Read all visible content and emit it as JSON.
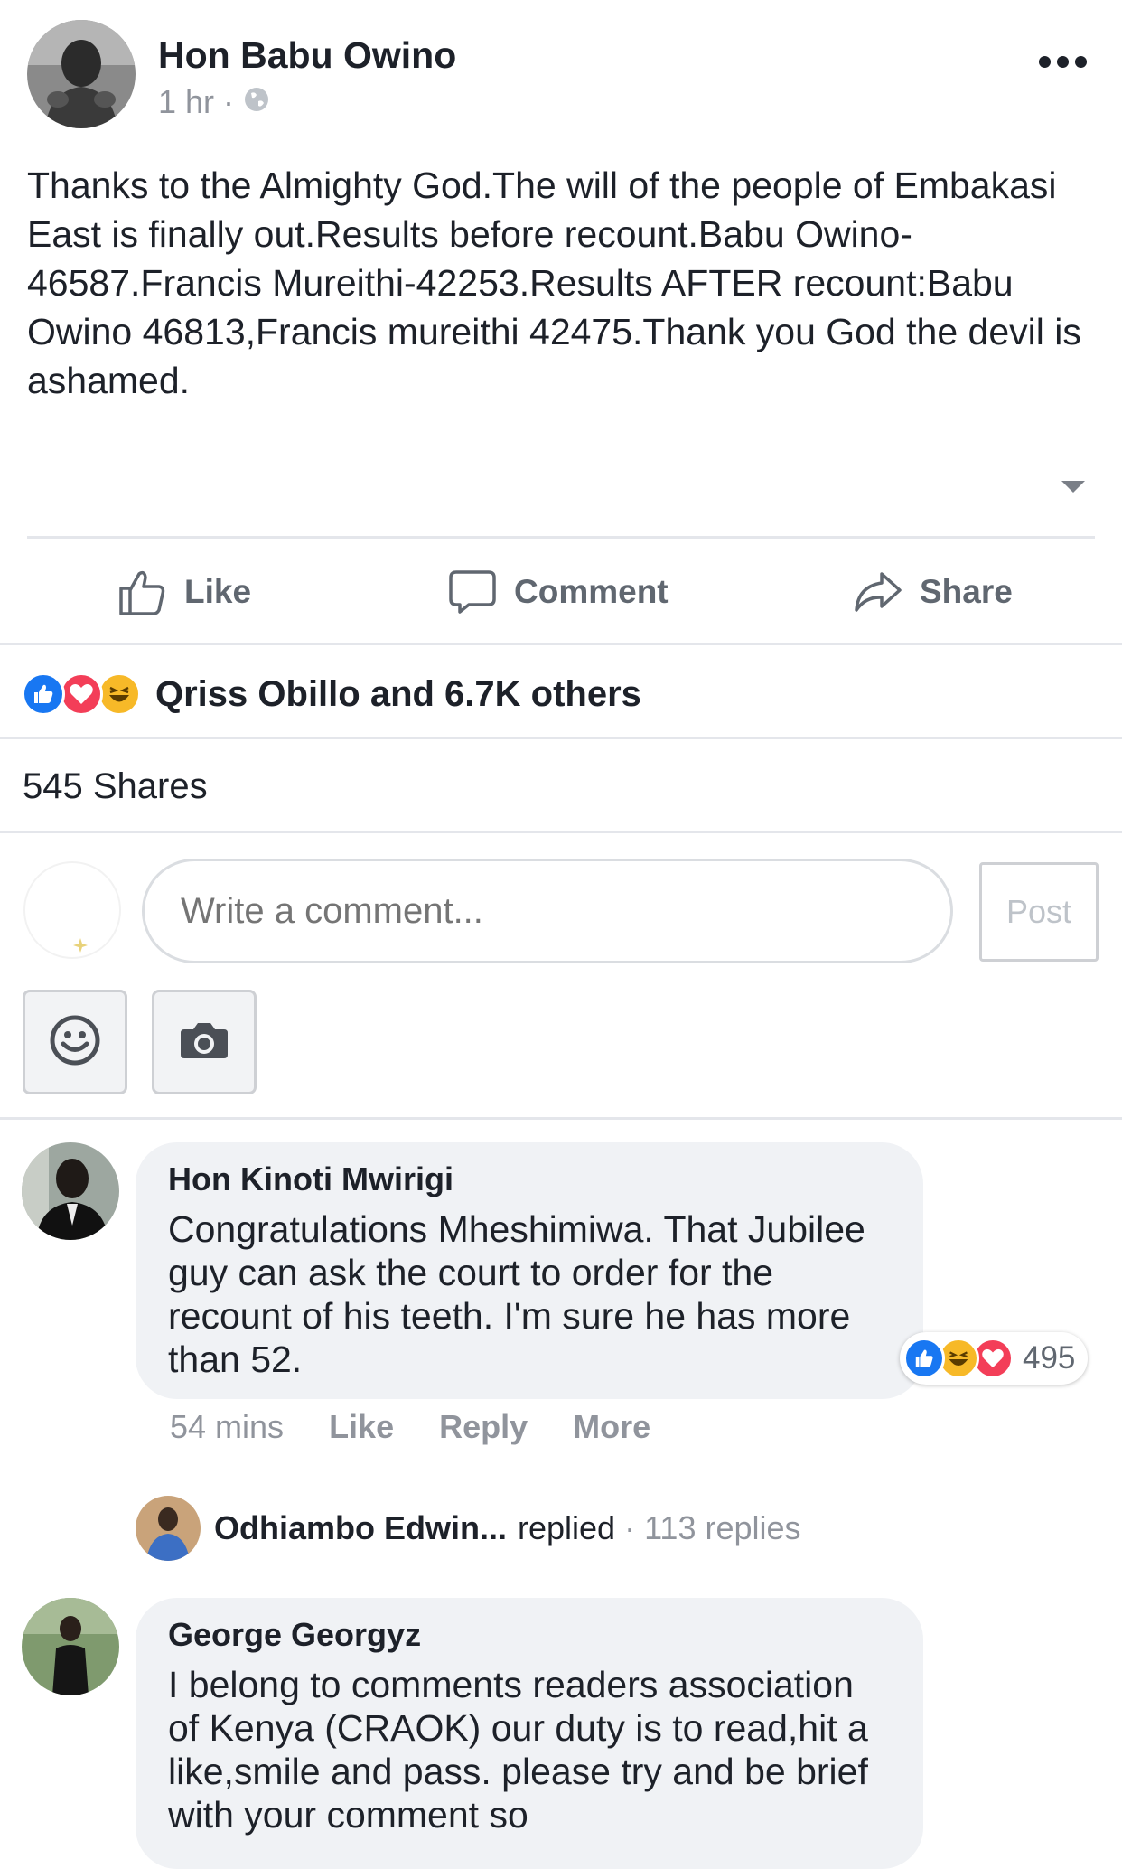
{
  "post": {
    "author": "Hon Babu Owino",
    "time": "1 hr",
    "text": "Thanks to the Almighty God.The will of the people of Embakasi East is finally out.Results before recount.Babu Owino-46587.Francis Mureithi-42253.Results AFTER recount:Babu Owino 46813,Francis mureithi 42475.Thank you God the devil is ashamed."
  },
  "actions": {
    "like": "Like",
    "comment": "Comment",
    "share": "Share"
  },
  "reactions": {
    "summary": "Qriss Obillo and 6.7K others",
    "types": [
      "like-icon",
      "love-icon",
      "haha-icon"
    ]
  },
  "shares": "545 Shares",
  "composer": {
    "placeholder": "Write a comment...",
    "post_label": "Post"
  },
  "comments": [
    {
      "author": "Hon Kinoti Mwirigi",
      "text": "Congratulations Mheshimiwa. That Jubilee guy can ask the court to order for the recount of his teeth. I'm sure he has more than 52.",
      "reaction_count": "495",
      "time": "54 mins",
      "like": "Like",
      "reply": "Reply",
      "more": "More",
      "reply_summary": {
        "name": "Odhiambo Edwin...",
        "verb": "replied",
        "count": "113 replies"
      }
    },
    {
      "author": "George Georgyz",
      "text": "I belong to comments readers association of Kenya (CRAOK) our duty is to read,hit a like,smile and pass. please try and be brief with your comment so"
    }
  ],
  "colors": {
    "like_blue": "#1877f2",
    "love_red": "#f33e58",
    "haha_yellow": "#f7b928",
    "muted": "#90949c"
  }
}
